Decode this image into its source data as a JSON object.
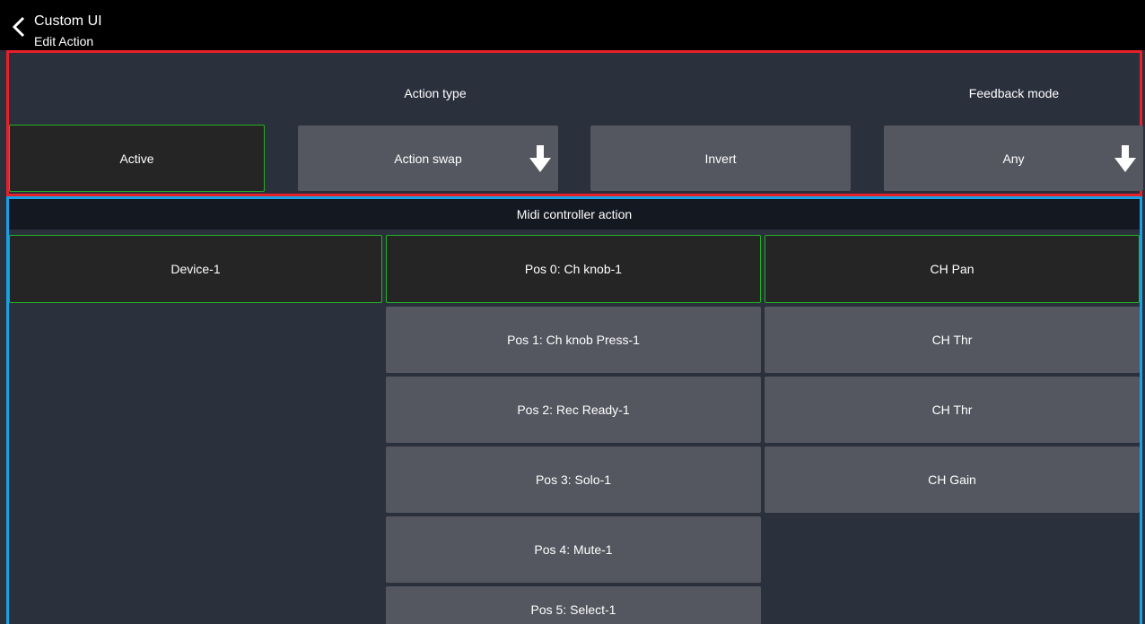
{
  "header": {
    "title": "Custom UI",
    "subtitle": "Edit Action",
    "back_icon": "chevron-left-icon"
  },
  "action_section": {
    "action_type_label": "Action type",
    "feedback_mode_label": "Feedback mode",
    "active_label": "Active",
    "action_type_value": "Action swap",
    "invert_label": "Invert",
    "feedback_mode_value": "Any",
    "dropdown_icon": "arrow-down-icon"
  },
  "midi_section": {
    "title": "Midi controller action",
    "devices": [
      "Device-1"
    ],
    "positions": [
      "Pos 0: Ch knob-1",
      "Pos 1: Ch knob Press-1",
      "Pos 2: Rec Ready-1",
      "Pos 3: Solo-1",
      "Pos 4: Mute-1",
      "Pos 5: Select-1"
    ],
    "functions": [
      "CH Pan",
      "CH Thr",
      "CH Thr",
      "CH Gain"
    ]
  },
  "colors": {
    "background": "#2a303c",
    "header_bg": "#000000",
    "selected_border": "#24b324",
    "button_grey": "#555760",
    "action_frame": "#e8202a",
    "midi_frame": "#17a2e6"
  }
}
